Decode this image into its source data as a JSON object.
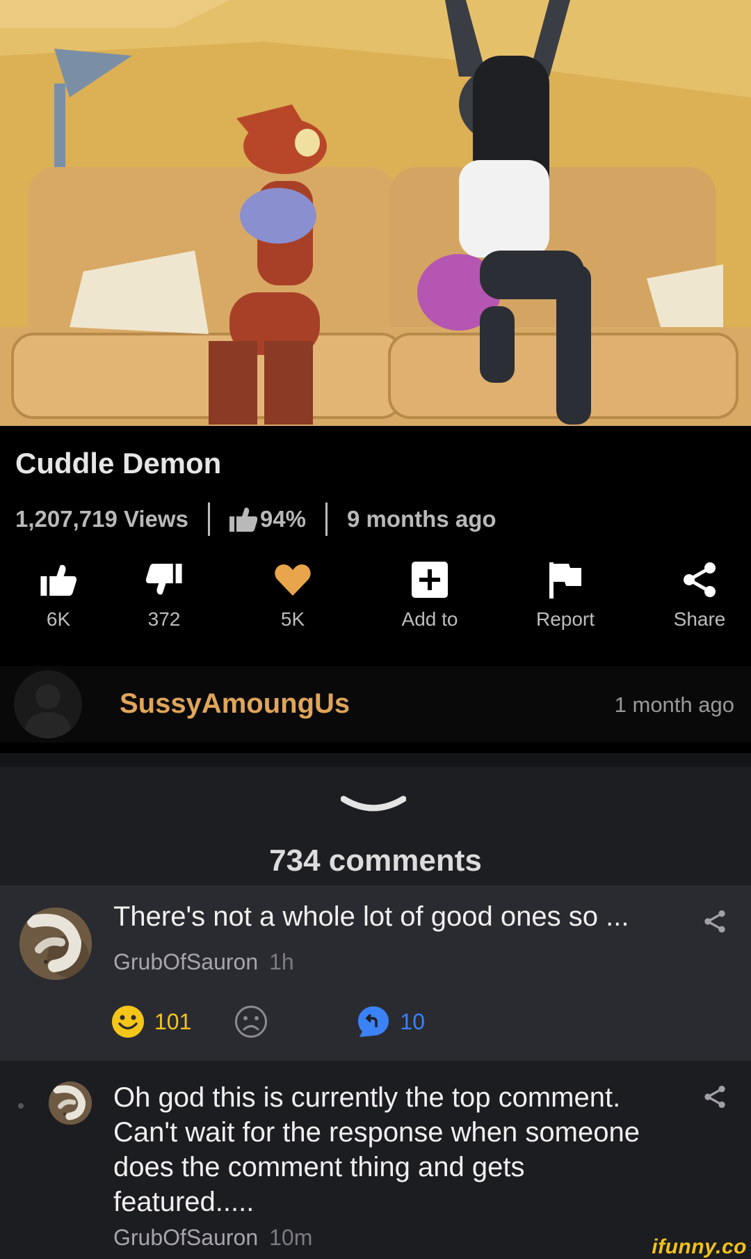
{
  "video": {
    "title": "Cuddle Demon",
    "views": "1,207,719 Views",
    "rating": "94%",
    "posted": "9 months ago"
  },
  "actions": [
    {
      "icon": "thumbs-up-icon",
      "label": "6K"
    },
    {
      "icon": "thumbs-down-icon",
      "label": "372"
    },
    {
      "icon": "heart-icon",
      "label": "5K"
    },
    {
      "icon": "add-box-icon",
      "label": "Add to"
    },
    {
      "icon": "flag-icon",
      "label": "Report"
    },
    {
      "icon": "share-icon",
      "label": "Share"
    }
  ],
  "uploader": {
    "name": "SussyAmoungUs",
    "time": "1 month ago"
  },
  "comments_header": {
    "count": "734 comments"
  },
  "comments": [
    {
      "text": "There's not a whole lot of good ones so ...",
      "author": "GrubOfSauron",
      "time": "1h",
      "smile_count": "101",
      "reply_count": "10"
    },
    {
      "text": "Oh god this is currently the top comment. Can't wait for the response when someone does the comment thing and gets featured.....",
      "author": "GrubOfSauron",
      "time": "10m"
    }
  ],
  "watermark": "ifunny.co",
  "colors": {
    "uploader": "#e0a55a",
    "heart": "#e8a54b",
    "smile": "#f5c518",
    "reply": "#3b82f6",
    "watermark": "#f1c21a"
  }
}
